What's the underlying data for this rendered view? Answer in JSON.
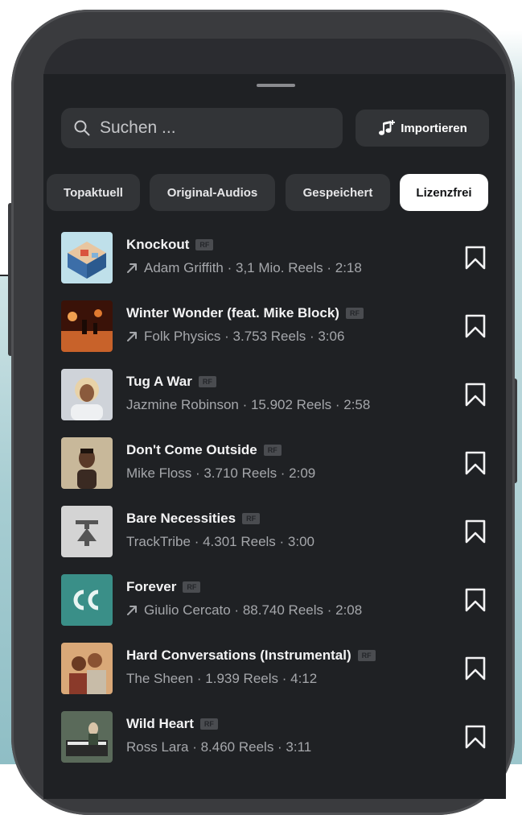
{
  "search": {
    "placeholder": "Suchen ..."
  },
  "import_label": "Importieren",
  "tabs": [
    {
      "label": "Topaktuell",
      "active": false
    },
    {
      "label": "Original-Audios",
      "active": false
    },
    {
      "label": "Gespeichert",
      "active": false
    },
    {
      "label": "Lizenzfrei",
      "active": true
    }
  ],
  "badge": "RF",
  "tracks": [
    {
      "title": "Knockout",
      "trending": true,
      "artist": "Adam Griffith",
      "reels": "3,1 Mio. Reels",
      "duration": "2:18",
      "thumb": "room"
    },
    {
      "title": "Winter Wonder (feat. Mike Block)",
      "trending": true,
      "artist": "Folk Physics",
      "reels": "3.753 Reels",
      "duration": "3:06",
      "thumb": "stage"
    },
    {
      "title": "Tug A War",
      "trending": false,
      "artist": "Jazmine Robinson",
      "reels": "15.902 Reels",
      "duration": "2:58",
      "thumb": "portrait-blonde"
    },
    {
      "title": "Don't Come Outside",
      "trending": false,
      "artist": "Mike Floss",
      "reels": "3.710 Reels",
      "duration": "2:09",
      "thumb": "portrait-man"
    },
    {
      "title": "Bare Necessities",
      "trending": false,
      "artist": "TrackTribe",
      "reels": "4.301 Reels",
      "duration": "3:00",
      "thumb": "tracktribe-logo"
    },
    {
      "title": "Forever",
      "trending": true,
      "artist": "Giulio Cercato",
      "reels": "88.740 Reels",
      "duration": "2:08",
      "thumb": "gc-logo"
    },
    {
      "title": "Hard Conversations (Instrumental)",
      "trending": false,
      "artist": "The Sheen",
      "reels": "1.939 Reels",
      "duration": "4:12",
      "thumb": "couple"
    },
    {
      "title": "Wild Heart",
      "trending": false,
      "artist": "Ross Lara",
      "reels": "8.460 Reels",
      "duration": "3:11",
      "thumb": "piano"
    }
  ]
}
